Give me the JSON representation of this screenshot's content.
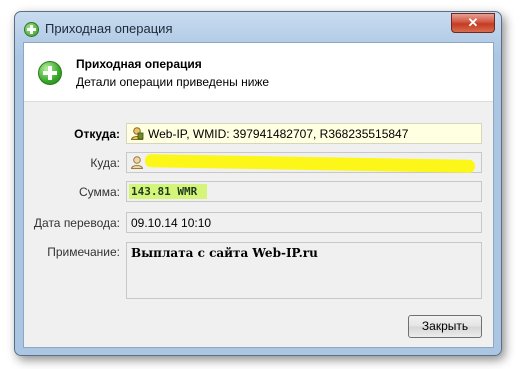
{
  "window": {
    "title": "Приходная операция",
    "close_glyph": "✕"
  },
  "header": {
    "title": "Приходная операция",
    "subtitle": "Детали операции приведены ниже",
    "icon": "add-circle-icon"
  },
  "fields": {
    "from_label": "Откуда:",
    "from_value": "Web-IP, WMID: 397941482707, R368235515847",
    "to_label": "Куда:",
    "to_value": "",
    "amount_label": "Сумма:",
    "amount_value": "143.81 WMR",
    "date_label": "Дата перевода:",
    "date_value": "09.10.14 10:10",
    "note_label": "Примечание:",
    "note_value": "Выплата с сайта Web-IP.ru"
  },
  "buttons": {
    "close_label": "Закрыть"
  },
  "colors": {
    "amount_highlight": "#d4f57a",
    "redaction": "#fcf718",
    "from_field_bg": "#ffffe1"
  }
}
